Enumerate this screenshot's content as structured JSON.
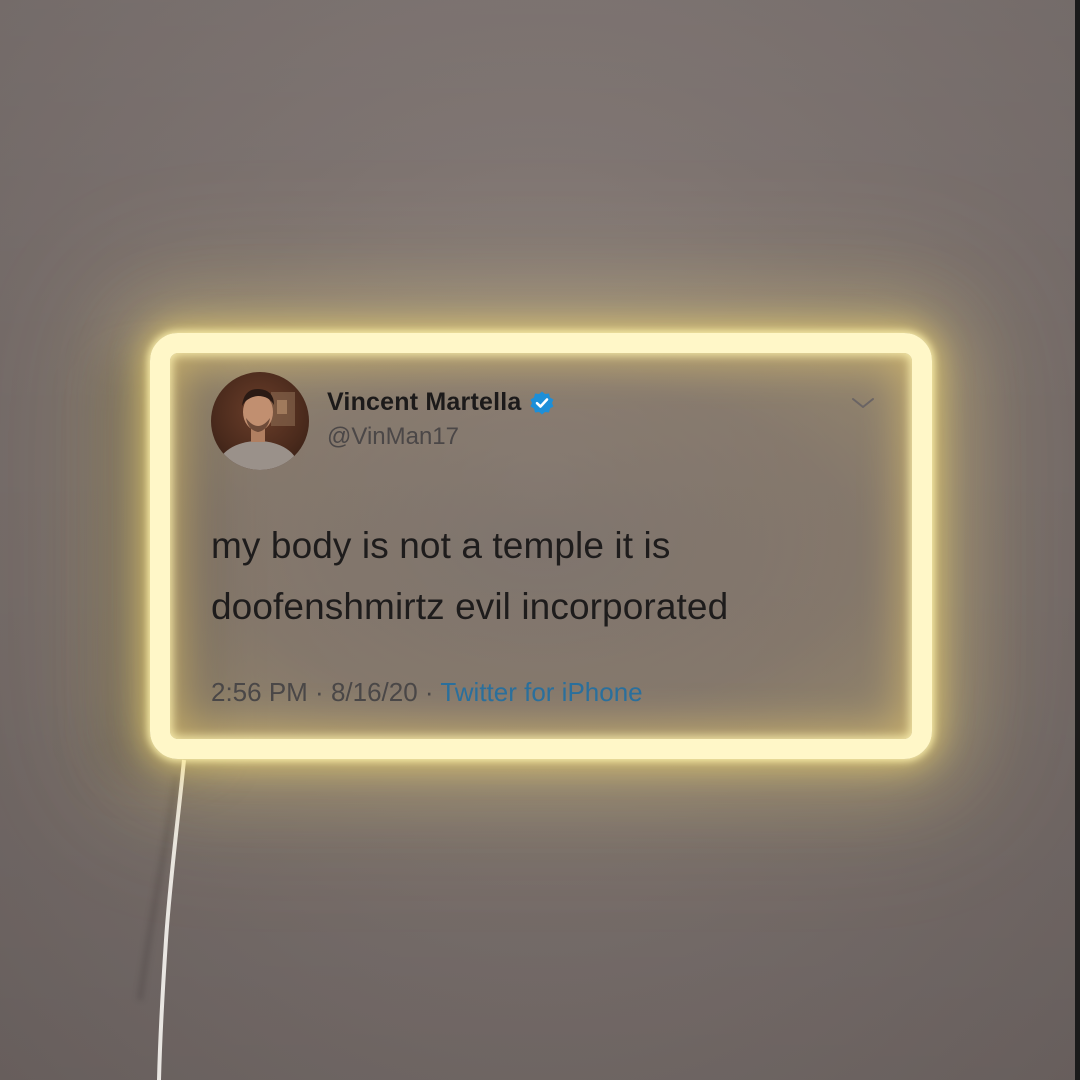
{
  "tweet": {
    "display_name": "Vincent Martella",
    "handle": "@VinMan17",
    "text": "my body is not a temple it is\ndoofenshmirtz evil incorporated",
    "time": "2:56 PM",
    "date": "8/16/20",
    "separator": " · ",
    "source": "Twitter for iPhone"
  },
  "icons": {
    "verified": "verified-badge-icon",
    "menu": "chevron-down-icon"
  },
  "colors": {
    "neon": "#fff7c8",
    "glow": "#ffe36e",
    "wall": "#7a706d",
    "link": "#2a6f9c",
    "verified": "#1d8fd8"
  }
}
